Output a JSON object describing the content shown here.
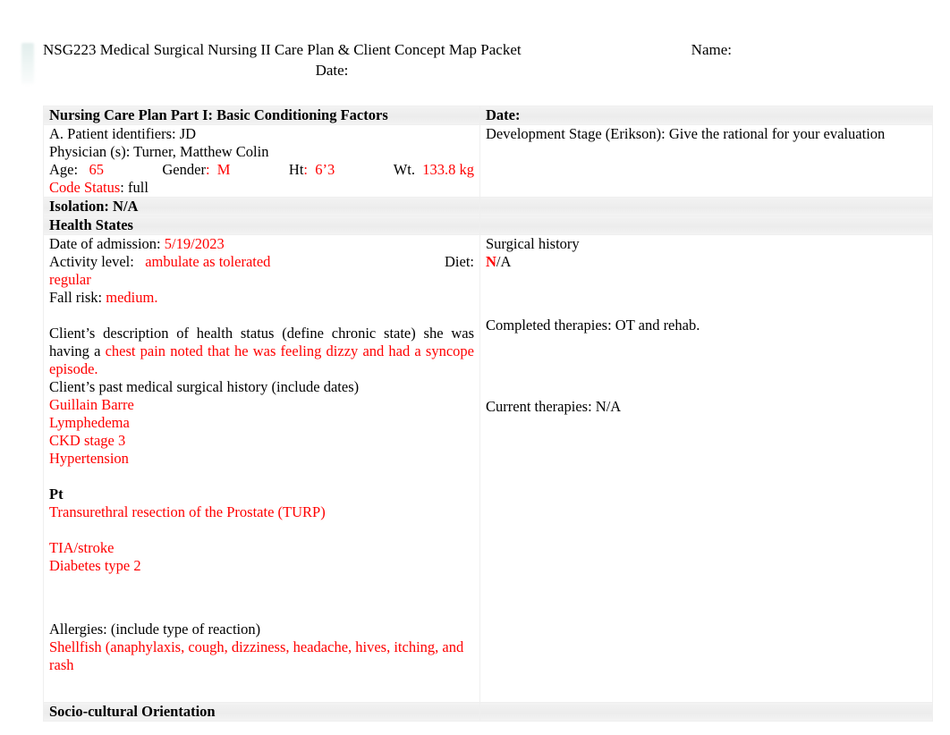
{
  "header": {
    "title": "NSG223 Medical Surgical Nursing II Care Plan & Client Concept Map Packet",
    "name_label": "Name:",
    "date_label": "Date:"
  },
  "colors": {
    "entry_red": "#ff0000",
    "text_black": "#000000",
    "shaded_row": "#f0f0f0"
  },
  "table": {
    "row1": {
      "left_header": "Nursing Care Plan Part I: Basic Conditioning Factors",
      "right_header": "Date:",
      "left": {
        "patient_identifiers_label": "A. Patient identifiers:",
        "patient_identifiers_value": "JD",
        "physician_label": "Physician (s):",
        "physician_value": "Turner, Matthew Colin",
        "age_label": "Age:",
        "age_value": "65",
        "gender_label": "Gender",
        "gender_colon": ":",
        "gender_value": "M",
        "ht_label": "Ht",
        "ht_colon": ":",
        "ht_value": "6’3",
        "wt_label": "Wt.",
        "wt_value": "133.8 kg",
        "code_status_label": "Code Status",
        "code_status_value": ": full",
        "isolation": "Isolation: N/A"
      },
      "right": {
        "development_stage": "Development Stage (Erikson): Give the rational for your evaluation"
      }
    },
    "row2": {
      "left_header": "Health States",
      "right_header": "",
      "left": {
        "admission_label": "Date of admission: ",
        "admission_value": "5/19/2023",
        "activity_label": "Activity level:   ",
        "activity_value": "ambulate as tolerated",
        "activity_value2": "regular",
        "diet_label": "Diet:   ",
        "fall_risk_label": "Fall risk: ",
        "fall_risk_value": "medium.",
        "description_label": "Client’s description of health status (define chronic state) she was having a ",
        "description_value": "chest pain noted that he was feeling dizzy and had a syncope episode.",
        "past_history_label": "Client’s past medical surgical history (include dates)",
        "past_history_items": [
          "Guillain Barre",
          "Lymphedema",
          "CKD stage 3",
          "Hypertension"
        ],
        "pt_label": "Pt",
        "pt_items": [
          "Transurethral resection of the Prostate (TURP)",
          "TIA/stroke",
          "Diabetes type 2"
        ],
        "allergies_label": "Allergies: (include type of reaction)",
        "allergies_value": "Shellfish (anaphylaxis, cough, dizziness, headache, hives, itching, and rash"
      },
      "right": {
        "surgical_history_label": "Surgical history",
        "diet_value_red": "N",
        "diet_value_black": "/A",
        "completed_therapies": "Completed therapies: OT and rehab.",
        "current_therapies": "Current therapies: N/A"
      }
    },
    "row3": {
      "left_header": "Socio-cultural Orientation",
      "right_header": ""
    }
  }
}
